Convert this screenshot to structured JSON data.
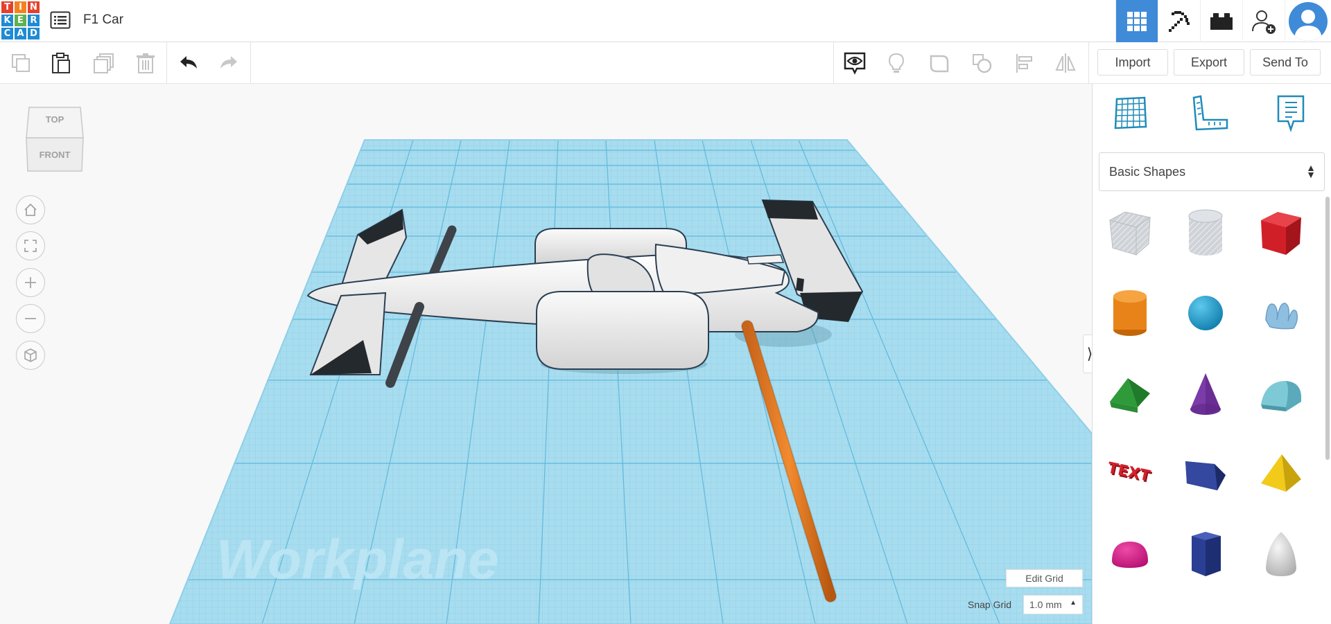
{
  "header": {
    "logo_letters": [
      "T",
      "I",
      "N",
      "K",
      "E",
      "R",
      "C",
      "A",
      "D"
    ],
    "logo_colors": [
      "#e5412d",
      "#e5412d",
      "#e5412d",
      "#1f8bd2",
      "#1f8bd2",
      "#1f8bd2",
      "#1f8bd2",
      "#1f8bd2",
      "#1f8bd2"
    ],
    "title": "F1 Car"
  },
  "toolbar": {
    "import_label": "Import",
    "export_label": "Export",
    "send_to_label": "Send To"
  },
  "viewport": {
    "viewcube_top": "TOP",
    "viewcube_front": "FRONT",
    "workplane_label": "Workplane",
    "edit_grid_label": "Edit Grid",
    "snap_grid_label": "Snap Grid",
    "snap_grid_value": "1.0 mm"
  },
  "panel": {
    "category": "Basic Shapes",
    "shapes": [
      "box-hole",
      "cylinder-hole",
      "box",
      "cylinder",
      "sphere",
      "scribble",
      "roof",
      "cone",
      "round-roof",
      "text",
      "wedge",
      "pyramid",
      "half-sphere",
      "polygon",
      "paraboloid"
    ]
  },
  "colors": {
    "accent": "#3f8bd8",
    "workplane": "#9fd9ee",
    "grid_line": "#6ec4e4"
  }
}
